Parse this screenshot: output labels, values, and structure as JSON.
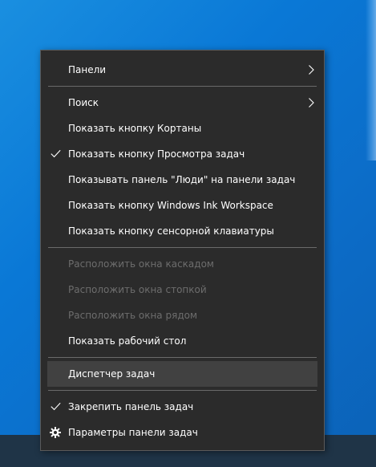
{
  "context_menu": {
    "items": [
      {
        "label": "Панели",
        "enabled": true,
        "submenu": true
      },
      {
        "label": "Поиск",
        "enabled": true,
        "submenu": true
      },
      {
        "label": "Показать кнопку Кортаны",
        "enabled": true
      },
      {
        "label": "Показать кнопку Просмотра задач",
        "enabled": true,
        "checked": true
      },
      {
        "label": "Показывать панель \"Люди\" на панели задач",
        "enabled": true
      },
      {
        "label": "Показать кнопку Windows Ink Workspace",
        "enabled": true
      },
      {
        "label": "Показать кнопку сенсорной клавиатуры",
        "enabled": true
      },
      {
        "label": "Расположить окна каскадом",
        "enabled": false
      },
      {
        "label": "Расположить окна стопкой",
        "enabled": false
      },
      {
        "label": "Расположить окна рядом",
        "enabled": false
      },
      {
        "label": "Показать рабочий стол",
        "enabled": true
      },
      {
        "label": "Диспетчер задач",
        "enabled": true,
        "highlighted": true
      },
      {
        "label": "Закрепить панель задач",
        "enabled": true,
        "checked": true
      },
      {
        "label": "Параметры панели задач",
        "enabled": true,
        "icon": "gear-icon"
      }
    ]
  },
  "colors": {
    "menu_background": "#2b2b2b",
    "menu_text": "#ffffff",
    "menu_text_disabled": "#6d6d6d",
    "menu_highlight": "#414141",
    "separator": "#6a6a6a",
    "desktop_blue": "#0a78d6"
  }
}
